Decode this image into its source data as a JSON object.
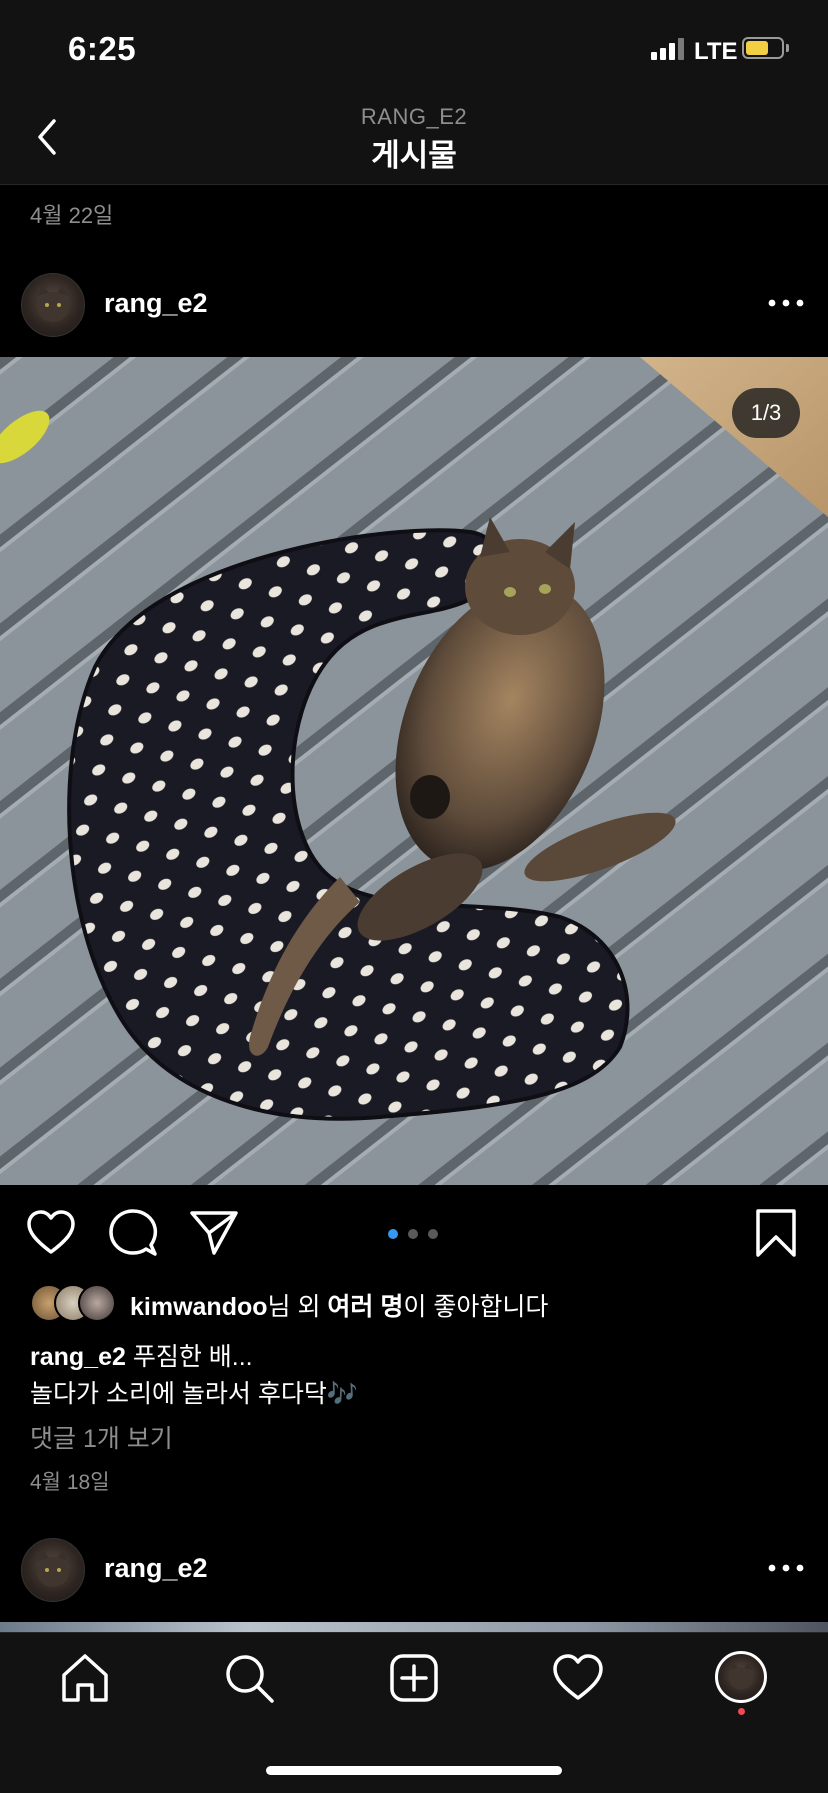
{
  "status_bar": {
    "time": "6:25",
    "network": "LTE",
    "battery_color": "#f2cf43"
  },
  "header": {
    "subtitle": "RANG_E2",
    "title": "게시물",
    "back_icon": "chevron-left-icon"
  },
  "previous_post": {
    "date": "4월 22일"
  },
  "post": {
    "username": "rang_e2",
    "more_icon": "ellipsis-icon",
    "media_counter": "1/3",
    "carousel": {
      "count": 3,
      "active_index": 0,
      "active_color": "#3897f0"
    },
    "likes": {
      "user": "kimwandoo",
      "suffix_1": "님 외 ",
      "others": "여러 명",
      "suffix_2": "이 좋아합니다"
    },
    "caption": {
      "username": "rang_e2",
      "line1": " 푸짐한 배...",
      "line2": "놀다가 소리에 놀라서 후다닥🎶"
    },
    "view_comments": "댓글 1개 보기",
    "date": "4월 18일"
  },
  "next_post": {
    "username": "rang_e2"
  },
  "tab_bar": {
    "items": [
      "home-icon",
      "search-icon",
      "new-post-icon",
      "activity-heart-icon",
      "profile-avatar"
    ],
    "notification_color": "#ed4956"
  }
}
